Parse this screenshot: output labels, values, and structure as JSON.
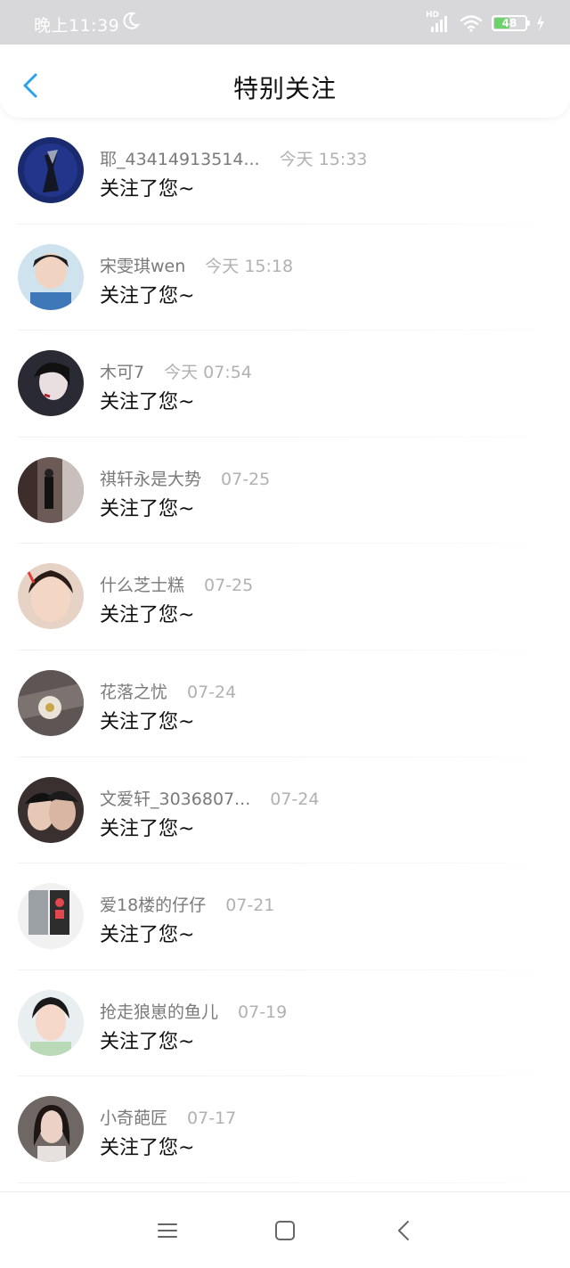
{
  "status_bar": {
    "time": "晚上11:39",
    "hd": "HD",
    "battery": "48"
  },
  "header": {
    "title": "特别关注"
  },
  "items": [
    {
      "name": "耶_43414913514...",
      "time": "今天 15:33",
      "message": "关注了您~"
    },
    {
      "name": "宋雯琪wen",
      "time": "今天 15:18",
      "message": "关注了您~"
    },
    {
      "name": "木可7",
      "time": "今天 07:54",
      "message": "关注了您~"
    },
    {
      "name": "祺轩永是大势",
      "time": "07-25",
      "message": "关注了您~"
    },
    {
      "name": "什么芝士糕",
      "time": "07-25",
      "message": "关注了您~"
    },
    {
      "name": "花落之忧",
      "time": "07-24",
      "message": "关注了您~"
    },
    {
      "name": "文爱轩_3036807...",
      "time": "07-24",
      "message": "关注了您~"
    },
    {
      "name": "爱18楼的仔仔",
      "time": "07-21",
      "message": "关注了您~"
    },
    {
      "name": "抢走狼崽的鱼儿",
      "time": "07-19",
      "message": "关注了您~"
    },
    {
      "name": "小奇葩匠",
      "time": "07-17",
      "message": "关注了您~"
    }
  ],
  "icons": {
    "moon": "moon-icon",
    "signal": "signal-icon",
    "wifi": "wifi-icon",
    "battery": "battery-icon",
    "charging": "charging-icon",
    "back": "back-arrow-icon",
    "menu": "menu-icon",
    "home": "home-square-icon",
    "nav_back": "nav-back-icon"
  },
  "colors": {
    "accent": "#2aa2ef",
    "status_bar": "#d8d8da",
    "battery_fill": "#6cd36a"
  }
}
